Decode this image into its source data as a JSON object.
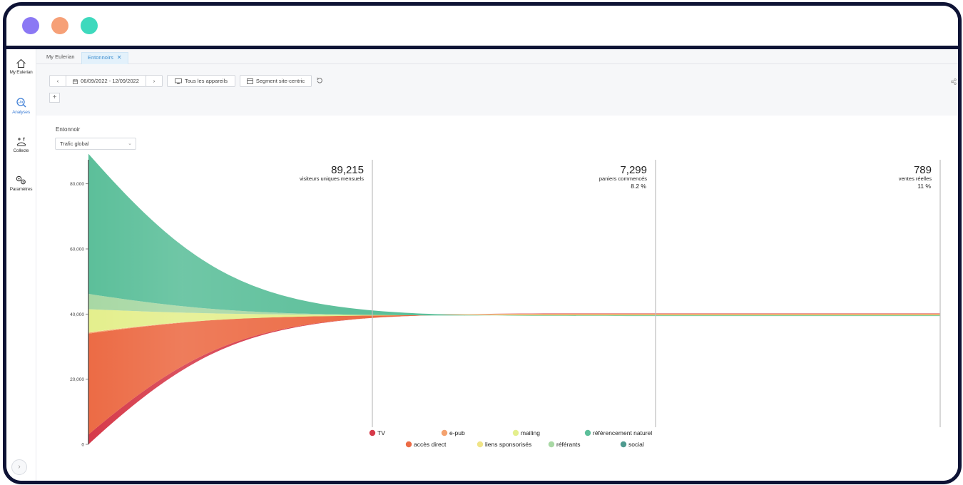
{
  "window": {
    "traffic_lights": [
      "#8b78f4",
      "#f6a077",
      "#3ed9bd"
    ]
  },
  "sidebar": {
    "items": [
      {
        "label": "My Eulerian",
        "icon": "home-icon"
      },
      {
        "label": "Analyses",
        "icon": "analysis-icon",
        "active": true
      },
      {
        "label": "Collecte",
        "icon": "collect-icon"
      },
      {
        "label": "Paramètres",
        "icon": "settings-gears-icon"
      }
    ],
    "toggle_glyph": "›"
  },
  "tabs": [
    {
      "label": "My Eulerian"
    },
    {
      "label": "Entonnoirs",
      "active": true,
      "close": "✕"
    }
  ],
  "toolbar": {
    "prev": "‹",
    "next": "›",
    "date_range": "06/09/2022 - 12/09/2022",
    "device": "Tous les appareils",
    "segment": "Segment site-centric",
    "add": "+"
  },
  "funnel": {
    "label": "Entonnoir",
    "selected": "Trafic global"
  },
  "colors": {
    "TV": "#d63a4a",
    "accès direct": "#ec6b45",
    "e-pub": "#f4a26f",
    "liens sponsorisés": "#f0e487",
    "mailing": "#e4ef8d",
    "référants": "#a8d8a4",
    "référencement naturel": "#5cbf9a",
    "social": "#4e9a8f"
  },
  "chart_data": {
    "type": "area",
    "stages": [
      {
        "value": "89,215",
        "label": "visiteurs uniques mensuels",
        "pct": ""
      },
      {
        "value": "7,299",
        "label": "paniers commencés",
        "pct": "8.2 %"
      },
      {
        "value": "789",
        "label": "ventes réelles",
        "pct": "11 %"
      }
    ],
    "y_ticks": [
      "0",
      "20,000",
      "40,000",
      "60,000",
      "80,000"
    ],
    "ylim": [
      0,
      90000
    ],
    "series": [
      {
        "name": "TV",
        "values": [
          3000,
          250,
          30
        ]
      },
      {
        "name": "accès direct",
        "values": [
          31000,
          2500,
          250
        ]
      },
      {
        "name": "e-pub",
        "values": [
          300,
          40,
          4
        ]
      },
      {
        "name": "liens sponsorisés",
        "values": [
          200,
          30,
          3
        ]
      },
      {
        "name": "mailing",
        "values": [
          7000,
          600,
          60
        ]
      },
      {
        "name": "référants",
        "values": [
          4700,
          400,
          40
        ]
      },
      {
        "name": "référencement naturel",
        "values": [
          43015,
          3479,
          402
        ]
      },
      {
        "name": "social",
        "values": [
          0,
          0,
          0
        ]
      }
    ],
    "legend": {
      "placement": "bottom",
      "rows": [
        [
          "TV",
          "e-pub",
          "mailing",
          "référencement naturel"
        ],
        [
          "accès direct",
          "liens sponsorisés",
          "référants",
          "social"
        ]
      ]
    }
  }
}
